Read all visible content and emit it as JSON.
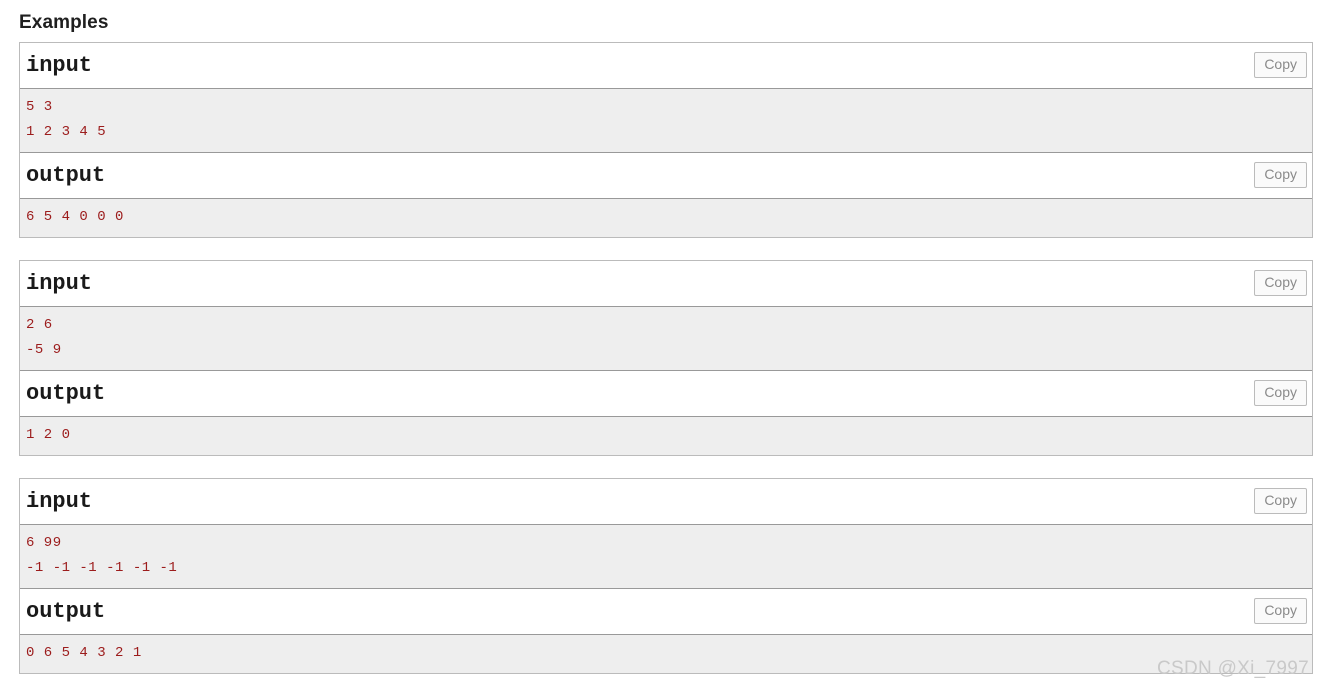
{
  "page": {
    "heading": "Examples",
    "watermark": "CSDN @Xi_7997"
  },
  "labels": {
    "input": "input",
    "output": "output",
    "copy": "Copy"
  },
  "colors": {
    "code_text": "#9c1c1c",
    "pre_background": "#eeeeee",
    "border": "#bbbbbb",
    "pre_border": "#999999",
    "watermark": "#c9c9c9"
  },
  "examples": [
    {
      "input_label": "input",
      "input_text": "5 3\n1 2 3 4 5",
      "input_copy": "Copy",
      "output_label": "output",
      "output_text": "6 5 4 0 0 0",
      "output_copy": "Copy"
    },
    {
      "input_label": "input",
      "input_text": "2 6\n-5 9",
      "input_copy": "Copy",
      "output_label": "output",
      "output_text": "1 2 0",
      "output_copy": "Copy"
    },
    {
      "input_label": "input",
      "input_text": "6 99\n-1 -1 -1 -1 -1 -1",
      "input_copy": "Copy",
      "output_label": "output",
      "output_text": "0 6 5 4 3 2 1",
      "output_copy": "Copy"
    }
  ]
}
